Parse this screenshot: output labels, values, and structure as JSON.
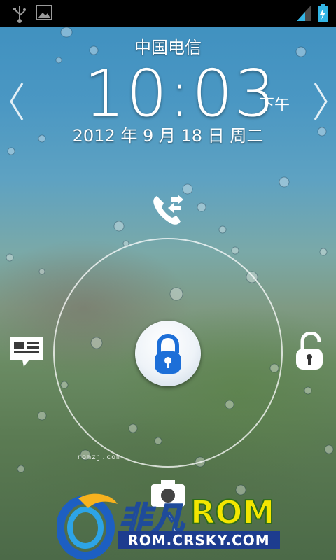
{
  "status_bar": {
    "left_icons": [
      "usb-icon",
      "image-icon"
    ],
    "right_icons": [
      "signal-icon",
      "battery-charging-icon"
    ]
  },
  "lockscreen": {
    "carrier": "中国电信",
    "time": "10:03",
    "ampm": "下午",
    "date": "2012 年 9 月 18 日 周二",
    "targets": {
      "top": "phone-icon",
      "left": "message-icon",
      "right": "unlock-icon",
      "bottom": "camera-icon",
      "center": "lock-icon"
    }
  },
  "watermark": "romzj.com",
  "brand": {
    "name_cn": "非凡",
    "name_en": "ROM",
    "url": "ROM.CRSKY.COM"
  },
  "colors": {
    "accent_blue": "#1d6fd8",
    "brand_yellow": "#f3e600",
    "brand_navy": "#1d3c8f"
  }
}
